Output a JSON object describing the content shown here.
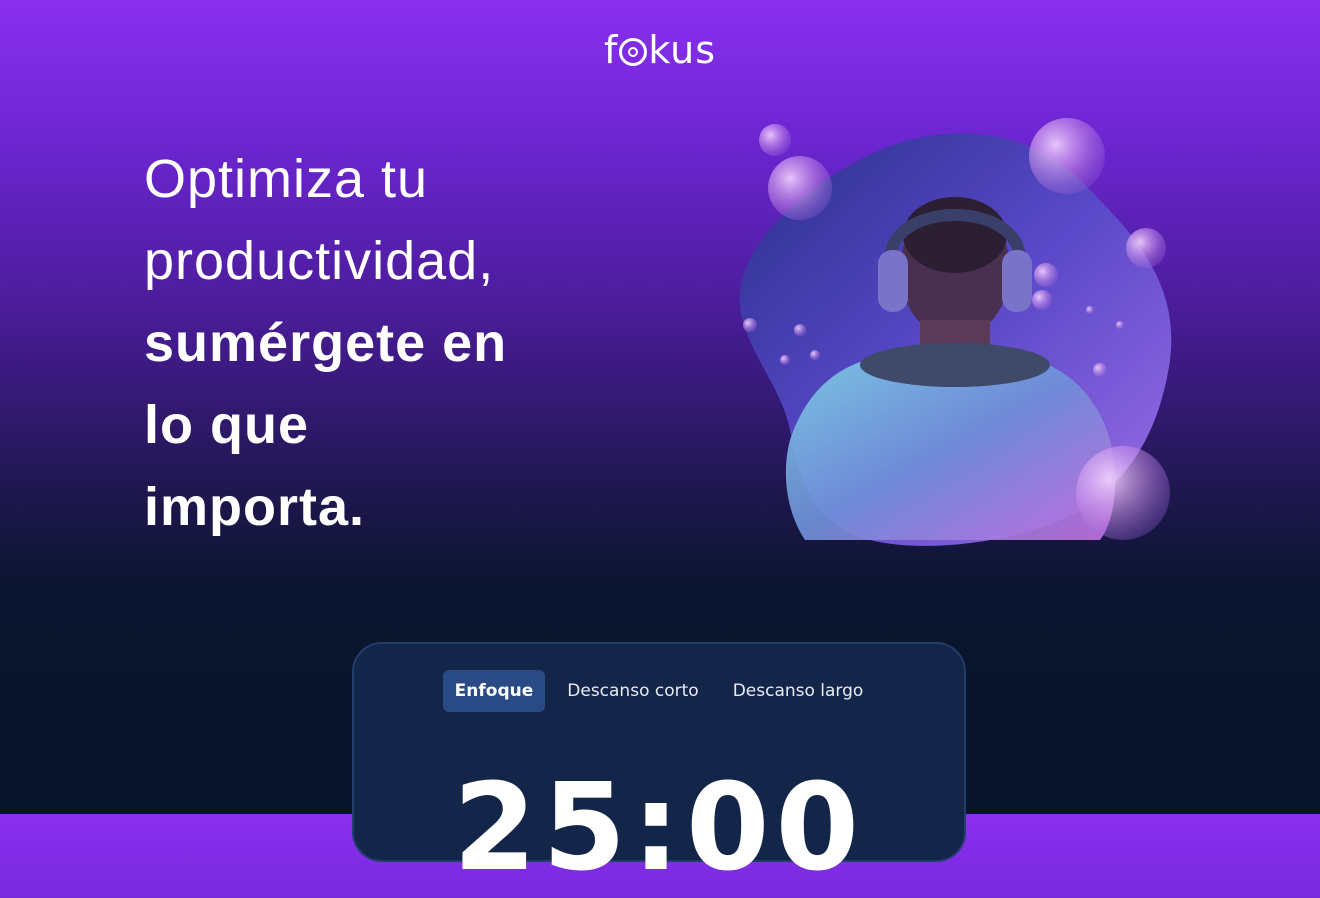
{
  "brand": {
    "logo_text_start": "f",
    "logo_text_end": "kus",
    "logo_icon": "target-icon"
  },
  "hero": {
    "lines_light": [
      "Optimiza tu",
      "productividad,"
    ],
    "lines_bold": [
      "sumérgete en",
      "lo que",
      "importa."
    ],
    "image": "person-with-headphones-and-bubbles"
  },
  "timer": {
    "tabs": [
      {
        "label": "Enfoque",
        "active": true
      },
      {
        "label": "Descanso corto",
        "active": false
      },
      {
        "label": "Descanso largo",
        "active": false
      }
    ],
    "time": "25:00"
  },
  "colors": {
    "background_top": "#8a2ff0",
    "background_bottom": "#071429",
    "card_background": "#132548",
    "active_tab": "#2a4a86"
  }
}
